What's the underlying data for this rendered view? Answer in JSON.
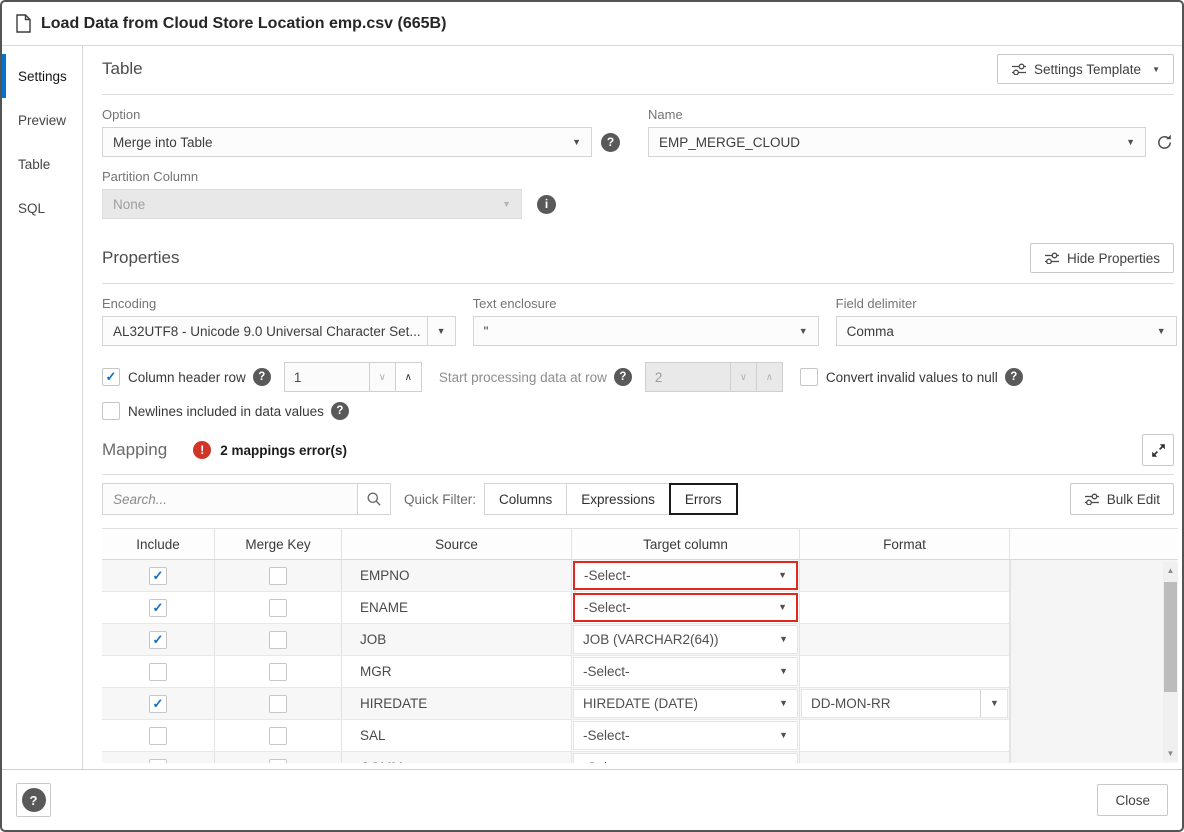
{
  "dialog": {
    "title": "Load Data from Cloud Store Location emp.csv (665B)"
  },
  "sidebar": {
    "items": [
      {
        "label": "Settings",
        "active": true
      },
      {
        "label": "Preview",
        "active": false
      },
      {
        "label": "Table",
        "active": false
      },
      {
        "label": "SQL",
        "active": false
      }
    ]
  },
  "table_section": {
    "heading": "Table",
    "settings_template_label": "Settings Template",
    "option_label": "Option",
    "option_value": "Merge into Table",
    "name_label": "Name",
    "name_value": "EMP_MERGE_CLOUD",
    "partition_label": "Partition Column",
    "partition_value": "None"
  },
  "properties_section": {
    "heading": "Properties",
    "hide_properties_label": "Hide Properties",
    "encoding_label": "Encoding",
    "encoding_value": "AL32UTF8 - Unicode 9.0 Universal Character Set...",
    "text_enclosure_label": "Text enclosure",
    "text_enclosure_value": "\"",
    "field_delimiter_label": "Field delimiter",
    "field_delimiter_value": "Comma",
    "column_header_row_label": "Column header row",
    "column_header_row_checked": true,
    "column_header_row_value": "1",
    "start_processing_label": "Start processing data at row",
    "start_processing_value": "2",
    "convert_invalid_label": "Convert invalid values to null",
    "convert_invalid_checked": false,
    "newlines_label": "Newlines included in data values",
    "newlines_checked": false
  },
  "mapping_section": {
    "heading": "Mapping",
    "error_summary": "2 mappings error(s)",
    "search_placeholder": "Search...",
    "quick_filter_label": "Quick Filter:",
    "filters": [
      {
        "label": "Columns",
        "active": false
      },
      {
        "label": "Expressions",
        "active": false
      },
      {
        "label": "Errors",
        "active": true
      }
    ],
    "bulk_edit_label": "Bulk Edit",
    "table": {
      "headers": [
        "Include",
        "Merge Key",
        "Source",
        "Target column",
        "Format"
      ],
      "rows": [
        {
          "include": true,
          "merge_key": false,
          "source": "EMPNO",
          "target": "-Select-",
          "target_error": true,
          "format": ""
        },
        {
          "include": true,
          "merge_key": false,
          "source": "ENAME",
          "target": "-Select-",
          "target_error": true,
          "format": ""
        },
        {
          "include": true,
          "merge_key": false,
          "source": "JOB",
          "target": "JOB (VARCHAR2(64))",
          "target_error": false,
          "format": ""
        },
        {
          "include": false,
          "merge_key": false,
          "source": "MGR",
          "target": "-Select-",
          "target_error": false,
          "format": ""
        },
        {
          "include": true,
          "merge_key": false,
          "source": "HIREDATE",
          "target": "HIREDATE (DATE)",
          "target_error": false,
          "format": "DD-MON-RR"
        },
        {
          "include": false,
          "merge_key": false,
          "source": "SAL",
          "target": "-Select-",
          "target_error": false,
          "format": ""
        },
        {
          "include": false,
          "merge_key": false,
          "source": "COMM",
          "target": "-Select-",
          "target_error": false,
          "format": ""
        }
      ]
    }
  },
  "footer": {
    "close_label": "Close"
  },
  "colors": {
    "accent": "#0572ce",
    "error": "#d0352a",
    "checkmark": "#0e6ec4",
    "icon_gray": "#595959"
  }
}
